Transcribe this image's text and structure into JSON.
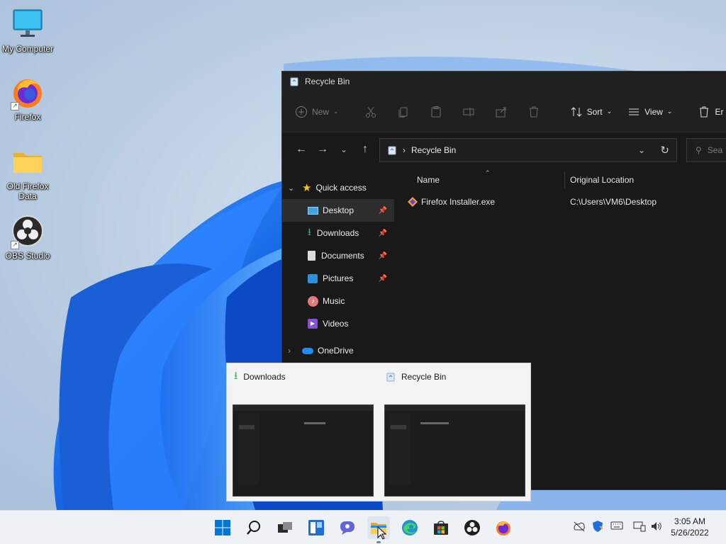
{
  "desktop": {
    "icons": [
      {
        "label": "My Computer",
        "icon": "monitor-icon"
      },
      {
        "label": "Firefox",
        "icon": "firefox-icon"
      },
      {
        "label": "Old Firefox Data",
        "icon": "folder-icon"
      },
      {
        "label": "OBS Studio",
        "icon": "obs-icon"
      }
    ]
  },
  "explorer": {
    "title": "Recycle Bin",
    "toolbar": {
      "new_label": "New",
      "sort_label": "Sort",
      "view_label": "View",
      "empty_label": "Er"
    },
    "address": {
      "path": "Recycle Bin"
    },
    "search": {
      "placeholder": "Sea"
    },
    "nav": {
      "quick_access": "Quick access",
      "items": [
        {
          "label": "Desktop",
          "icon": "desktop-icon",
          "pinned": true
        },
        {
          "label": "Downloads",
          "icon": "downloads-icon",
          "pinned": true
        },
        {
          "label": "Documents",
          "icon": "documents-icon",
          "pinned": true
        },
        {
          "label": "Pictures",
          "icon": "pictures-icon",
          "pinned": true
        },
        {
          "label": "Music",
          "icon": "music-icon",
          "pinned": false
        },
        {
          "label": "Videos",
          "icon": "videos-icon",
          "pinned": false
        }
      ],
      "onedrive": "OneDrive"
    },
    "columns": {
      "name": "Name",
      "original_location": "Original Location"
    },
    "files": [
      {
        "name": "Firefox Installer.exe",
        "original_location": "C:\\Users\\VM6\\Desktop"
      }
    ]
  },
  "taskbar_preview": {
    "windows": [
      {
        "title": "Downloads",
        "icon": "downloads-icon"
      },
      {
        "title": "Recycle Bin",
        "icon": "recycle-bin-icon"
      }
    ]
  },
  "taskbar": {
    "apps": [
      "start-icon",
      "search-icon",
      "task-view-icon",
      "widgets-icon",
      "chat-icon",
      "file-explorer-icon",
      "edge-icon",
      "store-icon",
      "obs-icon",
      "firefox-icon"
    ],
    "clock": {
      "time": "3:05 AM",
      "date": "5/26/2022"
    }
  },
  "colors": {
    "accent": "#0067c0",
    "explorer_bg": "#191919",
    "taskbar_bg": "#eef2f7"
  }
}
